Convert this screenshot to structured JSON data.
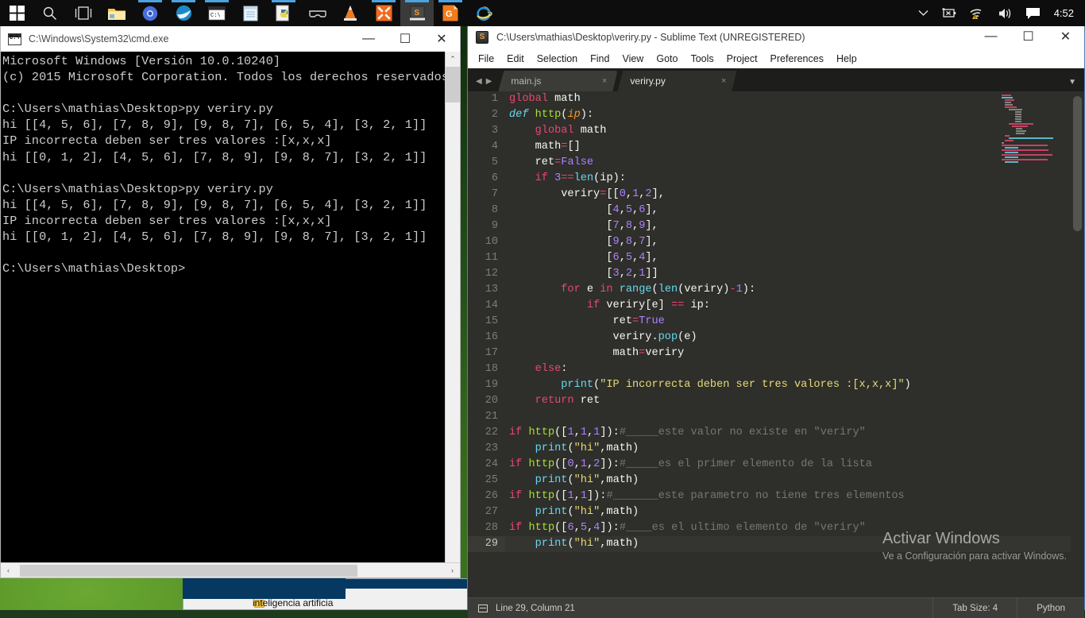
{
  "taskbar": {
    "icons": [
      {
        "name": "start-button",
        "label": "Start"
      },
      {
        "name": "search-icon",
        "label": "Search"
      },
      {
        "name": "task-view-icon",
        "label": "Task View"
      },
      {
        "name": "file-explorer-icon",
        "label": "File Explorer"
      },
      {
        "name": "chrome-icon",
        "label": "Google Chrome"
      },
      {
        "name": "browser-icon",
        "label": "Browser"
      },
      {
        "name": "cmd-icon",
        "label": "Command Prompt"
      },
      {
        "name": "notepad-icon",
        "label": "Notepad"
      },
      {
        "name": "python-idle-icon",
        "label": "Python IDLE"
      },
      {
        "name": "vr-headset-icon",
        "label": "VR"
      },
      {
        "name": "vlc-icon",
        "label": "VLC media player"
      },
      {
        "name": "xampp-icon",
        "label": "XAMPP"
      },
      {
        "name": "sublime-text-icon",
        "label": "Sublime Text"
      },
      {
        "name": "g-app-icon",
        "label": "G App"
      },
      {
        "name": "internet-explorer-icon",
        "label": "Internet Explorer"
      }
    ],
    "tray": {
      "chevron": "show-hidden-icons",
      "battery": "battery-not-detected-icon",
      "network": "wifi-warning-icon",
      "volume": "speaker-icon",
      "action_center": "notifications-icon",
      "clock": "4:52"
    }
  },
  "cmd": {
    "title": "C:\\Windows\\System32\\cmd.exe",
    "icon": "cmd-window-icon",
    "buttons": {
      "minimize": "—",
      "maximize": "☐",
      "close": "✕"
    },
    "output": "Microsoft Windows [Versión 10.0.10240]\n(c) 2015 Microsoft Corporation. Todos los derechos reservados.\n\nC:\\Users\\mathias\\Desktop>py veriry.py\nhi [[4, 5, 6], [7, 8, 9], [9, 8, 7], [6, 5, 4], [3, 2, 1]]\nIP incorrecta deben ser tres valores :[x,x,x]\nhi [[0, 1, 2], [4, 5, 6], [7, 8, 9], [9, 8, 7], [3, 2, 1]]\n\nC:\\Users\\mathias\\Desktop>py veriry.py\nhi [[4, 5, 6], [7, 8, 9], [9, 8, 7], [6, 5, 4], [3, 2, 1]]\nIP incorrecta deben ser tres valores :[x,x,x]\nhi [[0, 1, 2], [4, 5, 6], [7, 8, 9], [9, 8, 7], [3, 2, 1]]\n\nC:\\Users\\mathias\\Desktop>",
    "scroll_up_arrow": "⌃",
    "hscroll_left": "‹",
    "hscroll_right": "›"
  },
  "sublime": {
    "title": "C:\\Users\\mathias\\Desktop\\veriry.py - Sublime Text (UNREGISTERED)",
    "icon": "sublime-app-icon",
    "buttons": {
      "minimize": "—",
      "maximize": "☐",
      "close": "✕"
    },
    "menu": [
      "File",
      "Edit",
      "Selection",
      "Find",
      "View",
      "Goto",
      "Tools",
      "Project",
      "Preferences",
      "Help"
    ],
    "tabs": [
      {
        "label": "main.js",
        "close": "×",
        "active": false
      },
      {
        "label": "veriry.py",
        "close": "×",
        "active": true
      }
    ],
    "tab_nav": {
      "prev": "◀",
      "next": "▶",
      "menu": "▼"
    },
    "status": {
      "line_column": "Line 29, Column 21",
      "tab_size": "Tab Size: 4",
      "syntax": "Python"
    },
    "cursor": {
      "line": 29,
      "column": 21
    },
    "code_lines": [
      {
        "n": 1,
        "tokens": [
          [
            "k",
            "global"
          ],
          [
            "pl",
            " math"
          ]
        ]
      },
      {
        "n": 2,
        "tokens": [
          [
            "kd",
            "def"
          ],
          [
            "pl",
            " "
          ],
          [
            "fn",
            "http"
          ],
          [
            "pl",
            "("
          ],
          [
            "pa",
            "ip"
          ],
          [
            "pl",
            "):"
          ]
        ]
      },
      {
        "n": 3,
        "tokens": [
          [
            "pl",
            "    "
          ],
          [
            "k",
            "global"
          ],
          [
            "pl",
            " math"
          ]
        ]
      },
      {
        "n": 4,
        "tokens": [
          [
            "pl",
            "    math"
          ],
          [
            "op",
            "="
          ],
          [
            "pl",
            "[]"
          ]
        ]
      },
      {
        "n": 5,
        "tokens": [
          [
            "pl",
            "    ret"
          ],
          [
            "op",
            "="
          ],
          [
            "nu",
            "False"
          ]
        ]
      },
      {
        "n": 6,
        "tokens": [
          [
            "pl",
            "    "
          ],
          [
            "k",
            "if"
          ],
          [
            "pl",
            " "
          ],
          [
            "nu",
            "3"
          ],
          [
            "op",
            "=="
          ],
          [
            "bi",
            "len"
          ],
          [
            "pl",
            "(ip):"
          ]
        ]
      },
      {
        "n": 7,
        "tokens": [
          [
            "pl",
            "        veriry"
          ],
          [
            "op",
            "="
          ],
          [
            "pl",
            "[["
          ],
          [
            "nu",
            "0"
          ],
          [
            "pl",
            ","
          ],
          [
            "nu",
            "1"
          ],
          [
            "pl",
            ","
          ],
          [
            "nu",
            "2"
          ],
          [
            "pl",
            "],"
          ]
        ]
      },
      {
        "n": 8,
        "tokens": [
          [
            "pl",
            "               ["
          ],
          [
            "nu",
            "4"
          ],
          [
            "pl",
            ","
          ],
          [
            "nu",
            "5"
          ],
          [
            "pl",
            ","
          ],
          [
            "nu",
            "6"
          ],
          [
            "pl",
            "],"
          ]
        ]
      },
      {
        "n": 9,
        "tokens": [
          [
            "pl",
            "               ["
          ],
          [
            "nu",
            "7"
          ],
          [
            "pl",
            ","
          ],
          [
            "nu",
            "8"
          ],
          [
            "pl",
            ","
          ],
          [
            "nu",
            "9"
          ],
          [
            "pl",
            "],"
          ]
        ]
      },
      {
        "n": 10,
        "tokens": [
          [
            "pl",
            "               ["
          ],
          [
            "nu",
            "9"
          ],
          [
            "pl",
            ","
          ],
          [
            "nu",
            "8"
          ],
          [
            "pl",
            ","
          ],
          [
            "nu",
            "7"
          ],
          [
            "pl",
            "],"
          ]
        ]
      },
      {
        "n": 11,
        "tokens": [
          [
            "pl",
            "               ["
          ],
          [
            "nu",
            "6"
          ],
          [
            "pl",
            ","
          ],
          [
            "nu",
            "5"
          ],
          [
            "pl",
            ","
          ],
          [
            "nu",
            "4"
          ],
          [
            "pl",
            "],"
          ]
        ]
      },
      {
        "n": 12,
        "tokens": [
          [
            "pl",
            "               ["
          ],
          [
            "nu",
            "3"
          ],
          [
            "pl",
            ","
          ],
          [
            "nu",
            "2"
          ],
          [
            "pl",
            ","
          ],
          [
            "nu",
            "1"
          ],
          [
            "pl",
            "]]"
          ]
        ]
      },
      {
        "n": 13,
        "tokens": [
          [
            "pl",
            "        "
          ],
          [
            "k",
            "for"
          ],
          [
            "pl",
            " e "
          ],
          [
            "k",
            "in"
          ],
          [
            "pl",
            " "
          ],
          [
            "bi",
            "range"
          ],
          [
            "pl",
            "("
          ],
          [
            "bi",
            "len"
          ],
          [
            "pl",
            "(veriry)"
          ],
          [
            "op",
            "-"
          ],
          [
            "nu",
            "1"
          ],
          [
            "pl",
            "):"
          ]
        ]
      },
      {
        "n": 14,
        "tokens": [
          [
            "pl",
            "            "
          ],
          [
            "k",
            "if"
          ],
          [
            "pl",
            " veriry[e] "
          ],
          [
            "op",
            "=="
          ],
          [
            "pl",
            " ip:"
          ]
        ]
      },
      {
        "n": 15,
        "tokens": [
          [
            "pl",
            "                ret"
          ],
          [
            "op",
            "="
          ],
          [
            "nu",
            "True"
          ]
        ]
      },
      {
        "n": 16,
        "tokens": [
          [
            "pl",
            "                veriry."
          ],
          [
            "me",
            "pop"
          ],
          [
            "pl",
            "(e)"
          ]
        ]
      },
      {
        "n": 17,
        "tokens": [
          [
            "pl",
            "                math"
          ],
          [
            "op",
            "="
          ],
          [
            "pl",
            "veriry"
          ]
        ]
      },
      {
        "n": 18,
        "tokens": [
          [
            "pl",
            "    "
          ],
          [
            "k",
            "else"
          ],
          [
            "pl",
            ":"
          ]
        ]
      },
      {
        "n": 19,
        "tokens": [
          [
            "pl",
            "        "
          ],
          [
            "me",
            "print"
          ],
          [
            "pl",
            "("
          ],
          [
            "st",
            "\"IP incorrecta deben ser tres valores :[x,x,x]\""
          ],
          [
            "pl",
            ")"
          ]
        ]
      },
      {
        "n": 20,
        "tokens": [
          [
            "pl",
            "    "
          ],
          [
            "k",
            "return"
          ],
          [
            "pl",
            " ret"
          ]
        ]
      },
      {
        "n": 21,
        "tokens": [
          [
            "pl",
            ""
          ]
        ]
      },
      {
        "n": 22,
        "tokens": [
          [
            "k",
            "if"
          ],
          [
            "pl",
            " "
          ],
          [
            "fn",
            "http"
          ],
          [
            "pl",
            "(["
          ],
          [
            "nu",
            "1"
          ],
          [
            "pl",
            ","
          ],
          [
            "nu",
            "1"
          ],
          [
            "pl",
            ","
          ],
          [
            "nu",
            "1"
          ],
          [
            "pl",
            "]):"
          ],
          [
            "cm",
            "#_____este valor no existe en \"veriry\""
          ]
        ]
      },
      {
        "n": 23,
        "tokens": [
          [
            "pl",
            "    "
          ],
          [
            "me",
            "print"
          ],
          [
            "pl",
            "("
          ],
          [
            "st",
            "\"hi\""
          ],
          [
            "pl",
            ",math)"
          ]
        ]
      },
      {
        "n": 24,
        "tokens": [
          [
            "k",
            "if"
          ],
          [
            "pl",
            " "
          ],
          [
            "fn",
            "http"
          ],
          [
            "pl",
            "(["
          ],
          [
            "nu",
            "0"
          ],
          [
            "pl",
            ","
          ],
          [
            "nu",
            "1"
          ],
          [
            "pl",
            ","
          ],
          [
            "nu",
            "2"
          ],
          [
            "pl",
            "]):"
          ],
          [
            "cm",
            "#_____es el primer elemento de la lista"
          ]
        ]
      },
      {
        "n": 25,
        "tokens": [
          [
            "pl",
            "    "
          ],
          [
            "me",
            "print"
          ],
          [
            "pl",
            "("
          ],
          [
            "st",
            "\"hi\""
          ],
          [
            "pl",
            ",math)"
          ]
        ]
      },
      {
        "n": 26,
        "tokens": [
          [
            "k",
            "if"
          ],
          [
            "pl",
            " "
          ],
          [
            "fn",
            "http"
          ],
          [
            "pl",
            "(["
          ],
          [
            "nu",
            "1"
          ],
          [
            "pl",
            ","
          ],
          [
            "nu",
            "1"
          ],
          [
            "pl",
            "]):"
          ],
          [
            "cm",
            "#_______este parametro no tiene tres elementos"
          ]
        ]
      },
      {
        "n": 27,
        "tokens": [
          [
            "pl",
            "    "
          ],
          [
            "me",
            "print"
          ],
          [
            "pl",
            "("
          ],
          [
            "st",
            "\"hi\""
          ],
          [
            "pl",
            ",math)"
          ]
        ]
      },
      {
        "n": 28,
        "tokens": [
          [
            "k",
            "if"
          ],
          [
            "pl",
            " "
          ],
          [
            "fn",
            "http"
          ],
          [
            "pl",
            "(["
          ],
          [
            "nu",
            "6"
          ],
          [
            "pl",
            ","
          ],
          [
            "nu",
            "5"
          ],
          [
            "pl",
            ","
          ],
          [
            "nu",
            "4"
          ],
          [
            "pl",
            "]):"
          ],
          [
            "cm",
            "#____es el ultimo elemento de \"veriry\""
          ]
        ]
      },
      {
        "n": 29,
        "tokens": [
          [
            "pl",
            "    "
          ],
          [
            "me",
            "print"
          ],
          [
            "pl",
            "("
          ],
          [
            "st",
            "\"hi\""
          ],
          [
            "pl",
            ",math)"
          ]
        ],
        "current": true
      }
    ]
  },
  "watermark": {
    "title": "Activar Windows",
    "subtitle": "Ve a Configuración para activar Windows."
  },
  "background_window": {
    "label": "inteligencia artificia"
  },
  "colors": {
    "taskbar": "#0d0d0d",
    "accent": "#4aa3e0",
    "sublime_bg": "#2e2e2b",
    "sublime_status": "#3c3c38",
    "cmd_bg": "#000000",
    "cmd_text": "#cccccc",
    "keyword": "#e8486f",
    "string": "#e6db74",
    "number": "#ae81ff",
    "function": "#a6e22e",
    "builtin": "#66d9ef",
    "comment": "#76786e"
  }
}
